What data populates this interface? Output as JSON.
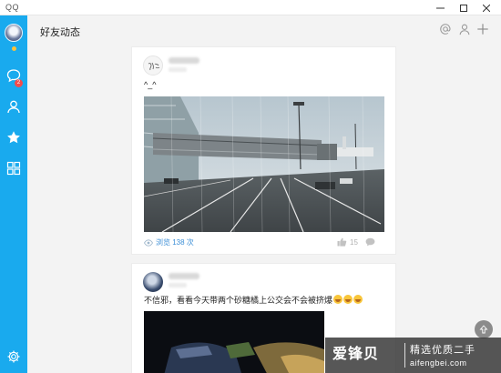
{
  "window": {
    "title": "QQ",
    "controls": [
      "minimize",
      "maximize",
      "close"
    ]
  },
  "sidebar": {
    "items": [
      {
        "icon": "avatar",
        "active": false
      },
      {
        "icon": "message-bubble-icon",
        "badge": "2"
      },
      {
        "icon": "contacts-person-icon"
      },
      {
        "icon": "star-icon",
        "active": true
      },
      {
        "icon": "apps-grid-icon"
      },
      {
        "icon": "settings-gear-icon"
      }
    ],
    "status_color": "#fbc23b"
  },
  "header": {
    "title": "好友动态",
    "icons": [
      "at-icon",
      "add-friend-icon",
      "plus-icon"
    ]
  },
  "feed": [
    {
      "text": "^_^",
      "views": "浏览 138 次",
      "likes": "15",
      "comments": "0",
      "image": "airport-jet-bridge-photo"
    },
    {
      "text": "不信邪，看看今天带两个砂糖橘上公交会不会被挤爆",
      "emoji_count": 3,
      "image": "dark-video-thumbnail"
    }
  ],
  "watermark": {
    "main": "爱锋贝",
    "sub": "精选优质二手",
    "url": "aifengbei.com"
  },
  "colors": {
    "sidebar": "#19aaee",
    "badge": "#f34c4c",
    "link": "#3b8ed6"
  }
}
